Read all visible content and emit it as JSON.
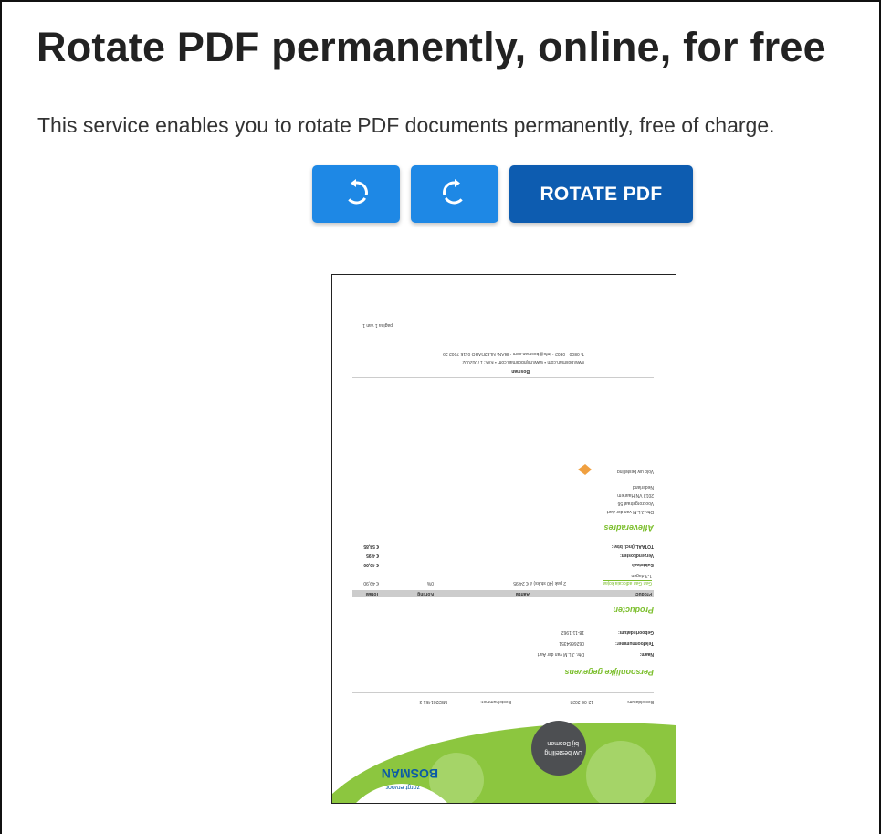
{
  "header": {
    "title": "Rotate PDF permanently, online, for free",
    "description": "This service enables you to rotate PDF documents permanently, free of charge."
  },
  "toolbar": {
    "rotate_left_icon": "rotate-ccw-icon",
    "rotate_right_icon": "rotate-cw-icon",
    "rotate_label": "ROTATE PDF"
  },
  "colors": {
    "button_blue": "#1e88e5",
    "button_dark_blue": "#0d5cb0",
    "doc_green": "#7cbf2d",
    "doc_dark_circle": "#4d4f52"
  },
  "preview": {
    "rotation": "180°",
    "page_footer": "pagina 1 van 1",
    "contact_line_1": "T: 0800 - 0802  •  info@bosman.com  •  IBAN: NL82RABO 0115 7002 29",
    "contact_line_2": "www.bosman.com  •  www.mijnbosman.com  •  KvK: 17002002",
    "company_small": "Bosman",
    "order_label": "Bestelnummer:",
    "order_value": "M82201451 3",
    "order_date_label": "Besteldatum:",
    "order_date_value": "12-06-2022",
    "section_personal": "Persoonlijke gegevens",
    "name_label": "Naam:",
    "name_value": "Dhr. J.L.M van der Aart",
    "phone_label": "Telefoonnummer:",
    "phone_value": "0626664351",
    "birth_label": "Geboortedatum:",
    "birth_value": "18-11-1962",
    "section_products": "Producten",
    "col_product": "Product",
    "col_amount": "Aantal",
    "col_discount": "Korting",
    "col_total": "Totaal",
    "product_name": "Gan Gan adlocaia kojaa",
    "product_sub": "1-3 dagen",
    "product_amount": "2 pak (40 stuks) à € 24,95",
    "product_discount": "0%",
    "product_total": "€ 49,90",
    "subtotal_label": "Subtotaal:",
    "subtotal_value": "€ 49,90",
    "shipping_label": "Verzendkosten:",
    "shipping_value": "€ 4,95",
    "total_label": "TOTAAL (incl. btw):",
    "total_value": "€ 54,85",
    "section_address": "Afleveradres",
    "addr_1": "Dhr. J.L.M van der Aart",
    "addr_2": "Voorzorgstraat 56",
    "addr_3": "2013 VN Haarlem",
    "addr_4": "Nederland",
    "follow_text": "Volg uw bestelling",
    "logo_text": "BOSMAN",
    "logo_tagline": "zorgt ervoor",
    "bubble_text": "Uw bestelling",
    "bubble_text_2": "bij Bosman"
  }
}
